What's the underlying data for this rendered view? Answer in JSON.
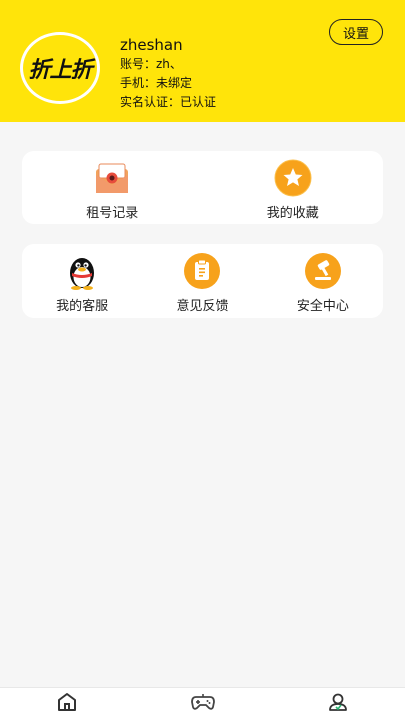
{
  "header": {
    "logo_text": "折上折",
    "username": "zheshan",
    "account": "账号：zh、",
    "phone": "手机：未绑定",
    "verify": "实名认证：已认证",
    "settings_label": "设置"
  },
  "menu1": {
    "items": [
      {
        "label": "租号记录",
        "icon": "rental-record-icon"
      },
      {
        "label": "我的收藏",
        "icon": "favorites-star-icon"
      }
    ]
  },
  "menu2": {
    "items": [
      {
        "label": "我的客服",
        "icon": "qq-penguin-icon"
      },
      {
        "label": "意见反馈",
        "icon": "feedback-clipboard-icon"
      },
      {
        "label": "安全中心",
        "icon": "security-hammer-icon"
      }
    ]
  },
  "nav": {
    "items": [
      {
        "icon": "home-icon"
      },
      {
        "icon": "gamepad-icon"
      },
      {
        "icon": "profile-icon"
      }
    ]
  },
  "colors": {
    "header_bg": "#ffe40a",
    "accent_orange": "#f7a21b",
    "page_bg": "#f6f6f6"
  }
}
